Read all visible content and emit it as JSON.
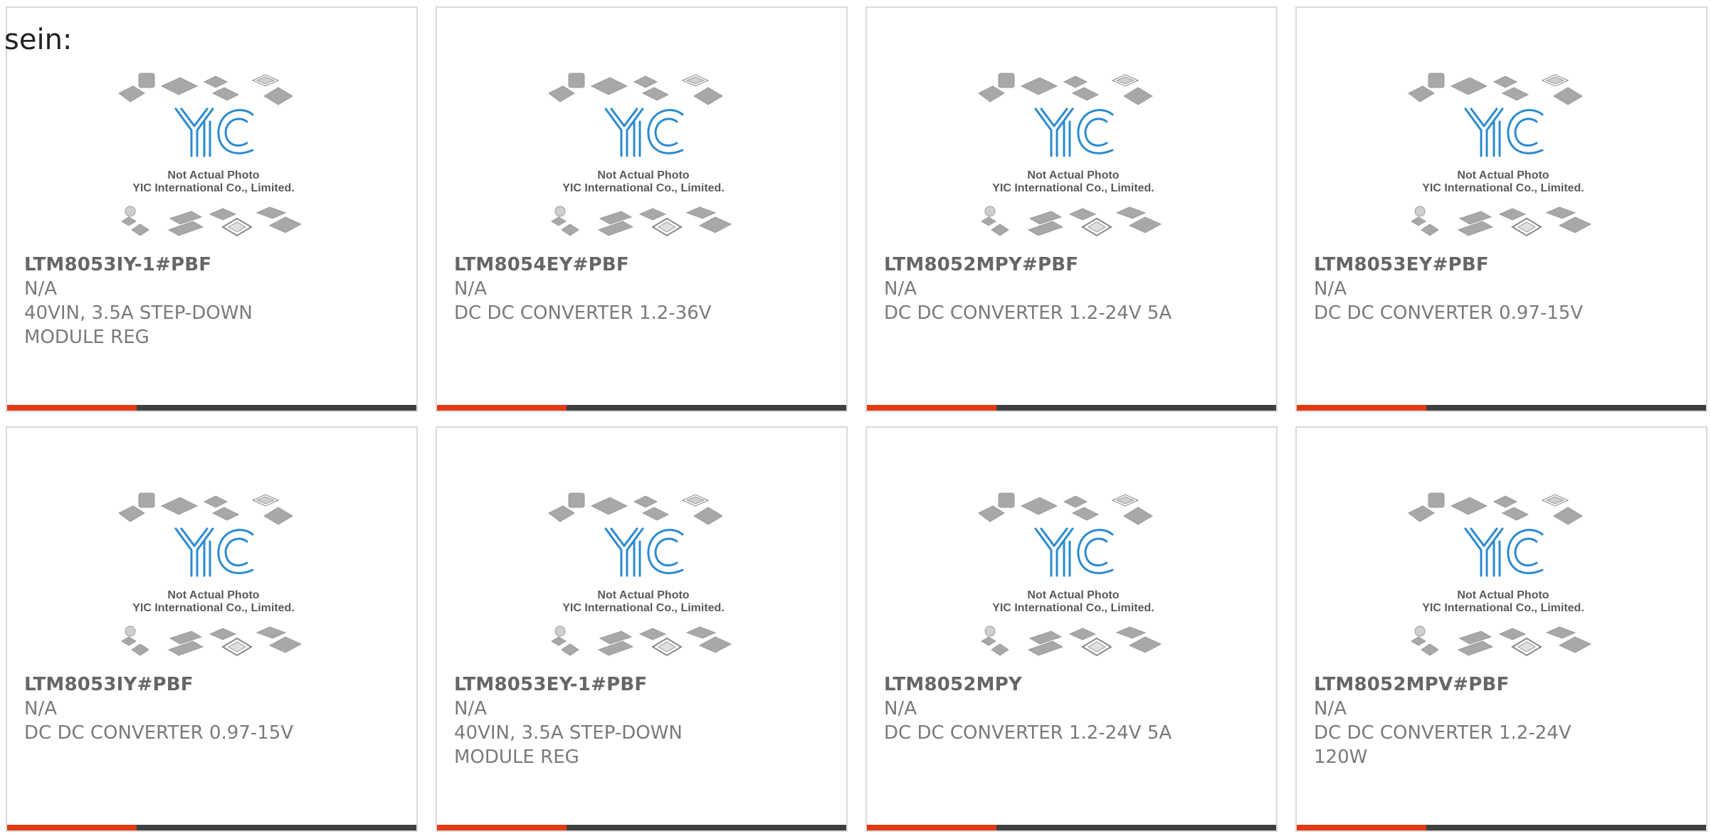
{
  "intro_text": "sein:",
  "photo": {
    "caption_line1": "Not Actual Photo",
    "caption_line2": "YIC International Co., Limited.",
    "logo_text": "YIC"
  },
  "colors": {
    "accent": "#e23a12",
    "bar_dark": "#404040",
    "logo_blue": "#2a8ad0",
    "chip_gray": "#a8a8a8"
  },
  "products": [
    {
      "part": "LTM8053IY-1#PBF",
      "manufacturer": "N/A",
      "description_lines": [
        "40VIN, 3.5A STEP-DOWN",
        "MODULE REG"
      ]
    },
    {
      "part": "LTM8054EY#PBF",
      "manufacturer": "N/A",
      "description_lines": [
        "DC DC CONVERTER 1.2-36V"
      ]
    },
    {
      "part": "LTM8052MPY#PBF",
      "manufacturer": "N/A",
      "description_lines": [
        "DC DC CONVERTER 1.2-24V 5A"
      ]
    },
    {
      "part": "LTM8053EY#PBF",
      "manufacturer": "N/A",
      "description_lines": [
        "DC DC CONVERTER 0.97-15V"
      ]
    },
    {
      "part": "LTM8053IY#PBF",
      "manufacturer": "N/A",
      "description_lines": [
        "DC DC CONVERTER 0.97-15V"
      ]
    },
    {
      "part": "LTM8053EY-1#PBF",
      "manufacturer": "N/A",
      "description_lines": [
        "40VIN, 3.5A STEP-DOWN",
        "MODULE REG"
      ]
    },
    {
      "part": "LTM8052MPY",
      "manufacturer": "N/A",
      "description_lines": [
        "DC DC CONVERTER 1.2-24V 5A"
      ]
    },
    {
      "part": "LTM8052MPV#PBF",
      "manufacturer": "N/A",
      "description_lines": [
        "DC DC CONVERTER 1.2-24V",
        "120W"
      ]
    }
  ]
}
